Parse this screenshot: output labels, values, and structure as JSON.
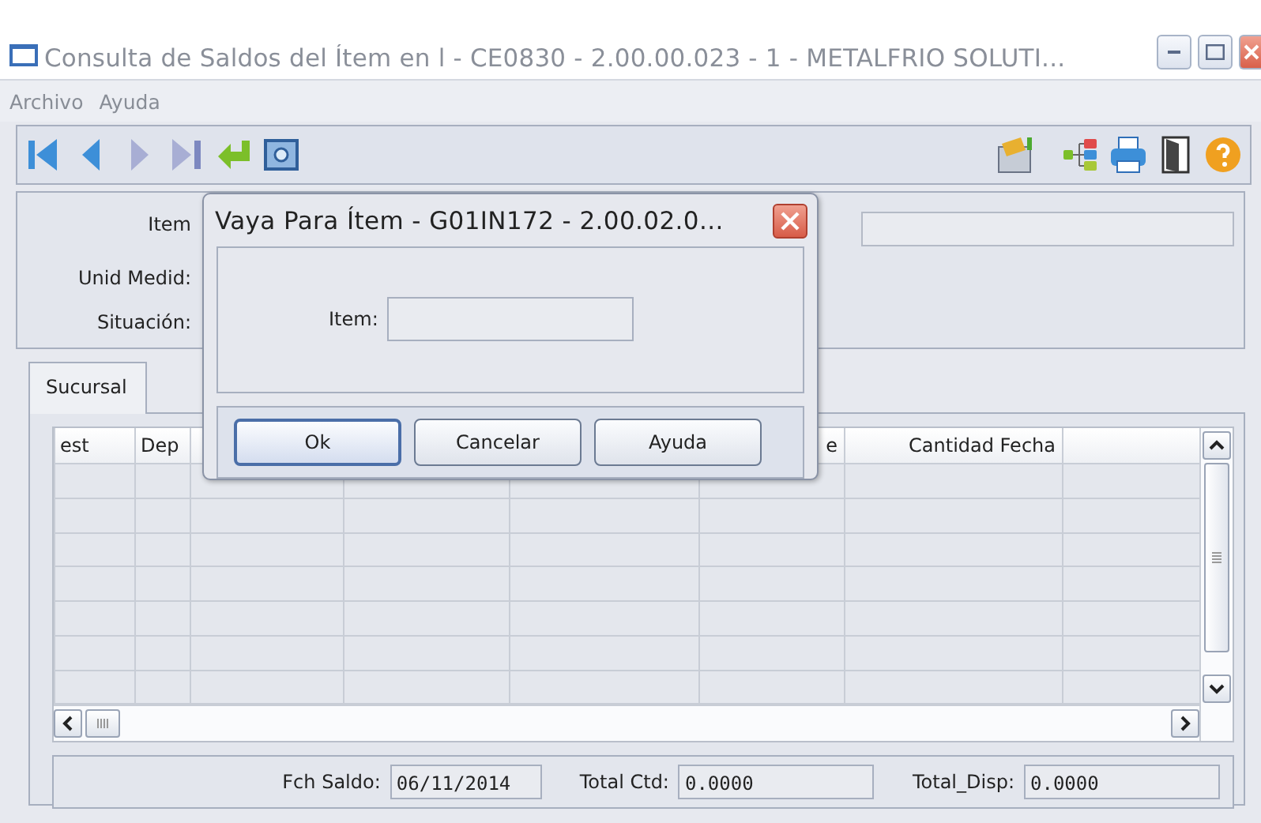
{
  "window": {
    "title": "Consulta de Saldos del Ítem en l - CE0830 - 2.00.00.023 - 1 - METALFRIO SOLUTI..."
  },
  "menu": [
    {
      "label": "Archivo"
    },
    {
      "label": "Ayuda"
    }
  ],
  "header_fields": [
    {
      "label": "Item"
    },
    {
      "label": "Unid Medid:"
    },
    {
      "label": "Situación:"
    }
  ],
  "tabs": [
    {
      "label": "Sucursal",
      "selected": true
    }
  ],
  "table": {
    "columns": [
      {
        "label": "est"
      },
      {
        "label": "Dep"
      },
      {},
      {},
      {},
      {
        "label": "e"
      },
      {
        "label": "Cantidad Fecha"
      },
      {}
    ]
  },
  "totals": [
    {
      "label": "Fch Saldo:",
      "value": "06/11/2014"
    },
    {
      "label": "Total Ctd:",
      "value": "0.0000"
    },
    {
      "label": "Total_Disp:",
      "value": "0.0000"
    }
  ],
  "dialog": {
    "title": "Vaya Para Ítem - G01IN172 - 2.00.02.0...",
    "field": {
      "label": "Item:"
    },
    "buttons": [
      {
        "label": "Ok",
        "selected": true
      },
      {
        "label": "Cancelar",
        "selected": false
      },
      {
        "label": "Ayuda",
        "selected": false
      }
    ]
  }
}
